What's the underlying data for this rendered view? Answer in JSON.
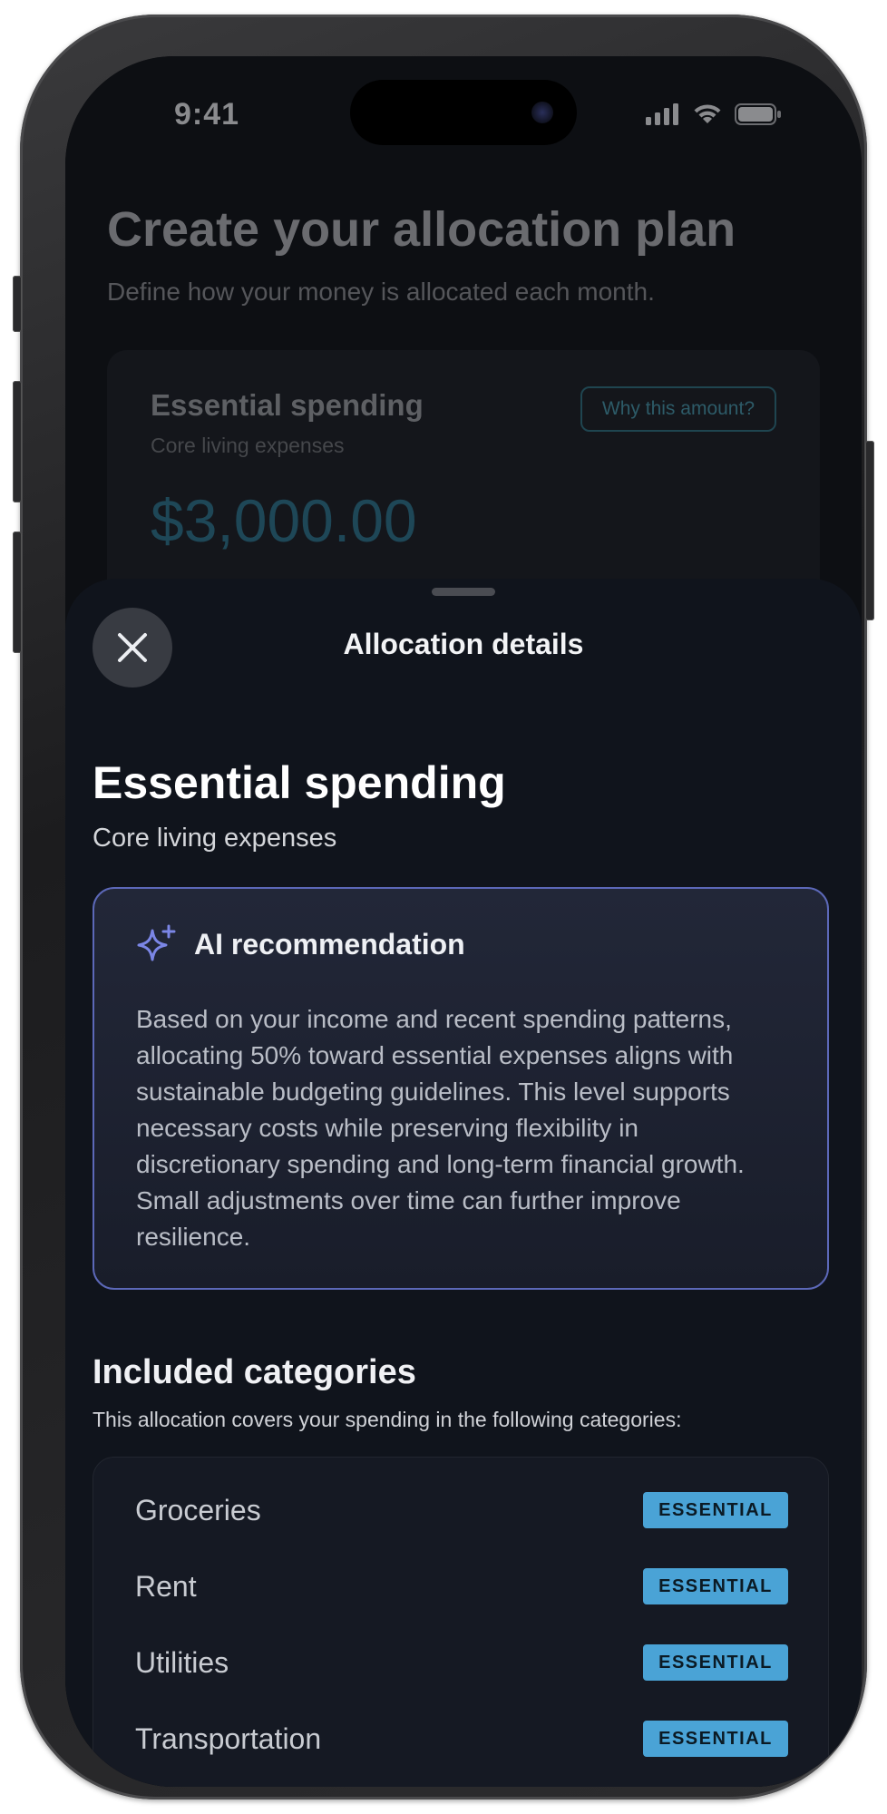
{
  "status_bar": {
    "time": "9:41",
    "icons": [
      "cellular-signal-icon",
      "wifi-icon",
      "battery-icon"
    ]
  },
  "background_page": {
    "title": "Create your allocation plan",
    "subtitle": "Define how your money is allocated each month.",
    "card": {
      "title": "Essential spending",
      "subtitle": "Core living expenses",
      "why_button": "Why this amount?",
      "amount": "$3,000.00"
    }
  },
  "sheet": {
    "title": "Allocation details",
    "close_icon": "close-icon",
    "section_title": "Essential spending",
    "section_subtitle": "Core living expenses",
    "ai": {
      "icon": "sparkle-icon",
      "label": "AI recommendation",
      "body": "Based on your income and recent spending patterns, allocating 50% toward essential expenses aligns with sustainable budgeting guidelines. This level supports necessary costs while preserving flexibility in discretionary spending and long-term financial growth. Small adjustments over time can further improve resilience."
    },
    "categories": {
      "title": "Included categories",
      "subtitle": "This allocation covers your spending in the following categories:",
      "items": [
        {
          "name": "Groceries",
          "tag": "ESSENTIAL"
        },
        {
          "name": "Rent",
          "tag": "ESSENTIAL"
        },
        {
          "name": "Utilities",
          "tag": "ESSENTIAL"
        },
        {
          "name": "Transportation",
          "tag": "ESSENTIAL"
        }
      ]
    }
  },
  "colors": {
    "accent_blue": "#4aa3d6",
    "ai_border": "#5c68b8",
    "sheet_bg": "#10141c"
  }
}
